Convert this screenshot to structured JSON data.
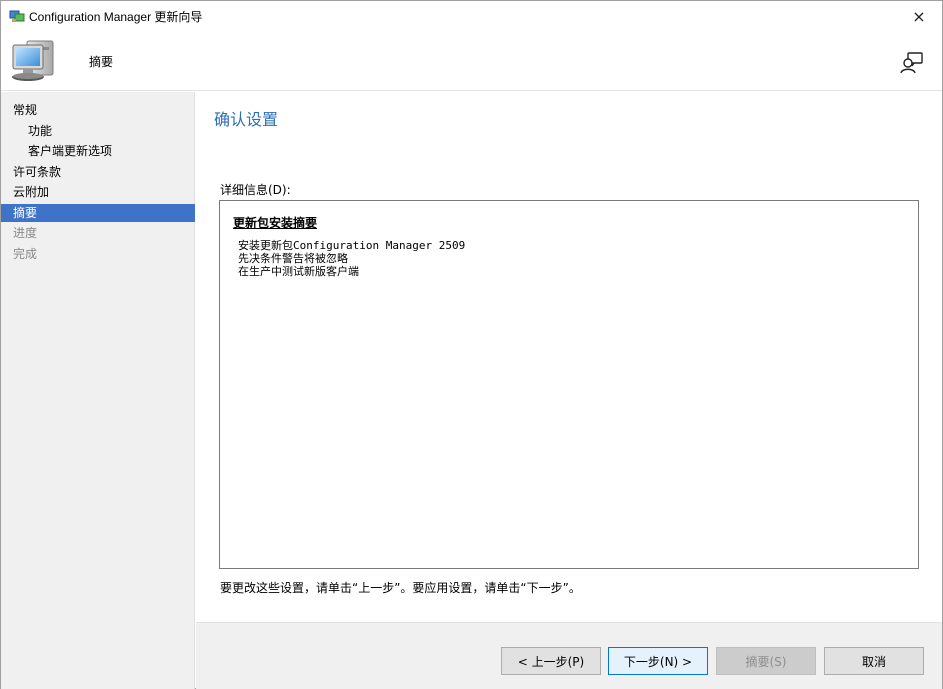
{
  "window": {
    "title": "Configuration Manager 更新向导",
    "close_glyph": "×"
  },
  "header": {
    "title": "摘要"
  },
  "sidebar": {
    "items": [
      {
        "label": "常规",
        "state": "normal",
        "level": 0
      },
      {
        "label": "功能",
        "state": "normal",
        "level": 1
      },
      {
        "label": "客户端更新选项",
        "state": "normal",
        "level": 1
      },
      {
        "label": "许可条款",
        "state": "normal",
        "level": 0
      },
      {
        "label": "云附加",
        "state": "normal",
        "level": 0
      },
      {
        "label": "摘要",
        "state": "active",
        "level": 0
      },
      {
        "label": "进度",
        "state": "disabled",
        "level": 0
      },
      {
        "label": "完成",
        "state": "disabled",
        "level": 0
      }
    ]
  },
  "main": {
    "heading": "确认设置",
    "details_label": "详细信息(D):",
    "summary_heading": "更新包安装摘要",
    "summary_lines": [
      "安装更新包Configuration Manager 2509",
      "先决条件警告将被忽略",
      "在生产中测试新版客户端"
    ],
    "hint": "要更改这些设置，请单击“上一步”。要应用设置，请单击“下一步”。"
  },
  "footer": {
    "back_label": "< 上一步(P)",
    "next_label": "下一步(N) >",
    "summary_label": "摘要(S)",
    "cancel_label": "取消"
  },
  "colors": {
    "accent": "#3f73c8",
    "heading_blue": "#2f6fb5",
    "sidebar_bg": "#f0f0f0"
  },
  "icons": {
    "app": "configmgr-app-icon",
    "header": "computer-icon",
    "help": "help-person-icon"
  }
}
